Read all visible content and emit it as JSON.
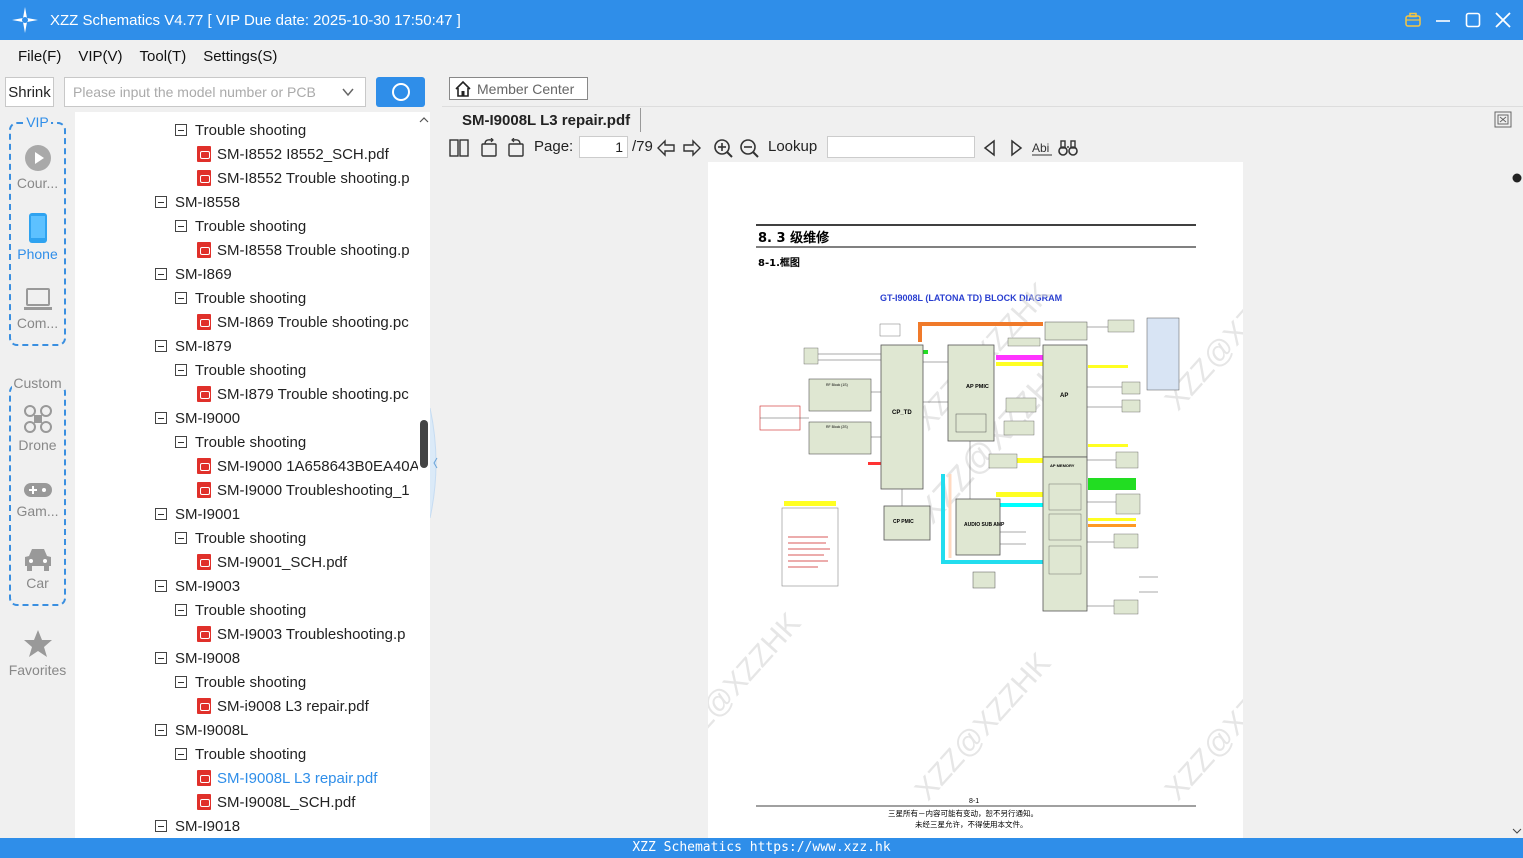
{
  "window": {
    "title": "XZZ Schematics V4.77 [ VIP Due date: 2025-10-30 17:50:47 ]"
  },
  "menu": [
    "File(F)",
    "VIP(V)",
    "Tool(T)",
    "Settings(S)"
  ],
  "leftnav": {
    "shrink_label": "Shrink",
    "vip_label": "VIP",
    "custom_label": "Custom",
    "items": [
      {
        "label": "Cour...",
        "icon": "play-icon",
        "active": false
      },
      {
        "label": "Phone",
        "icon": "phone-icon",
        "active": true
      },
      {
        "label": "Com...",
        "icon": "laptop-icon",
        "active": false
      },
      {
        "label": "Drone",
        "icon": "drone-icon",
        "active": false
      },
      {
        "label": "Gam...",
        "icon": "gamepad-icon",
        "active": false
      },
      {
        "label": "Car",
        "icon": "car-icon",
        "active": false
      },
      {
        "label": "Favorites",
        "icon": "star-icon",
        "active": false
      }
    ]
  },
  "search": {
    "placeholder": "Please input the model number or PCB"
  },
  "tree": [
    {
      "level": 1,
      "type": "folder",
      "label": "Trouble shooting"
    },
    {
      "level": 2,
      "type": "pdf",
      "label": "SM-I8552 I8552_SCH.pdf"
    },
    {
      "level": 2,
      "type": "pdf",
      "label": "SM-I8552 Trouble shooting.p"
    },
    {
      "level": 0,
      "type": "folder",
      "label": "SM-I8558"
    },
    {
      "level": 1,
      "type": "folder",
      "label": "Trouble shooting"
    },
    {
      "level": 2,
      "type": "pdf",
      "label": "SM-I8558 Trouble shooting.p"
    },
    {
      "level": 0,
      "type": "folder",
      "label": "SM-I869"
    },
    {
      "level": 1,
      "type": "folder",
      "label": "Trouble shooting"
    },
    {
      "level": 2,
      "type": "pdf",
      "label": "SM-I869 Trouble shooting.pc"
    },
    {
      "level": 0,
      "type": "folder",
      "label": "SM-I879"
    },
    {
      "level": 1,
      "type": "folder",
      "label": "Trouble shooting"
    },
    {
      "level": 2,
      "type": "pdf",
      "label": "SM-I879 Trouble shooting.pc"
    },
    {
      "level": 0,
      "type": "folder",
      "label": "SM-I9000"
    },
    {
      "level": 1,
      "type": "folder",
      "label": "Trouble shooting"
    },
    {
      "level": 2,
      "type": "pdf",
      "label": "SM-I9000 1A658643B0EA40A"
    },
    {
      "level": 2,
      "type": "pdf",
      "label": "SM-I9000 Troubleshooting_1"
    },
    {
      "level": 0,
      "type": "folder",
      "label": "SM-I9001"
    },
    {
      "level": 1,
      "type": "folder",
      "label": "Trouble shooting"
    },
    {
      "level": 2,
      "type": "pdf",
      "label": "SM-I9001_SCH.pdf"
    },
    {
      "level": 0,
      "type": "folder",
      "label": "SM-I9003"
    },
    {
      "level": 1,
      "type": "folder",
      "label": "Trouble shooting"
    },
    {
      "level": 2,
      "type": "pdf",
      "label": "SM-I9003 Troubleshooting.p"
    },
    {
      "level": 0,
      "type": "folder",
      "label": "SM-I9008"
    },
    {
      "level": 1,
      "type": "folder",
      "label": "Trouble shooting"
    },
    {
      "level": 2,
      "type": "pdf",
      "label": "SM-i9008 L3 repair.pdf"
    },
    {
      "level": 0,
      "type": "folder",
      "label": "SM-I9008L"
    },
    {
      "level": 1,
      "type": "folder",
      "label": "Trouble shooting"
    },
    {
      "level": 2,
      "type": "pdf",
      "label": "SM-I9008L L3 repair.pdf",
      "selected": true
    },
    {
      "level": 2,
      "type": "pdf",
      "label": "SM-I9008L_SCH.pdf"
    },
    {
      "level": 0,
      "type": "folder",
      "label": "SM-I9018"
    }
  ],
  "doc": {
    "member_center": "Member Center",
    "tab_title": "SM-I9008L L3 repair.pdf",
    "page_label": "Page:",
    "page_current": "1",
    "page_total": "/79",
    "lookup_label": "Lookup",
    "page_content": {
      "heading": "8. 3 级维修",
      "subheading": "8-1.框图",
      "diagram_title": "GT-I9008L (LATONA TD) BLOCK DIAGRAM",
      "blocks": {
        "cp_td": "CP_TD",
        "ap_pmic": "AP PMIC",
        "ap": "AP",
        "cp_pmic": "CP PMIC",
        "audio": "AUDIO SUB AMP",
        "ap_memory": "AP MEMORY",
        "rf1": "RF Block (1S)",
        "rf2": "RF Block (2S)"
      },
      "page_number": "8-1",
      "footer_line1": "三星所有－内容可能有变动，恕不另行通知。",
      "footer_line2": "未经三星允许，不得使用本文件。",
      "watermark": "XZZ@XZZHK"
    }
  },
  "status": {
    "text": "XZZ Schematics https://www.xzz.hk"
  },
  "colors": {
    "accent": "#2f8ee9",
    "pdf_icon": "#e0302a"
  }
}
